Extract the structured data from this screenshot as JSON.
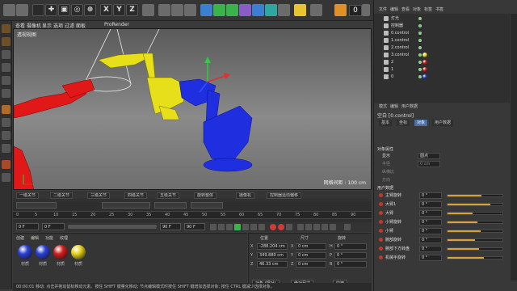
{
  "toolbar": {
    "axis_x": "X",
    "axis_y": "Y",
    "axis_z": "Z",
    "frame_value": "0"
  },
  "viewport": {
    "menu": [
      "查看",
      "摄像机",
      "显示",
      "选项",
      "过滤",
      "面板",
      "ProRender"
    ],
    "label": "透视视图",
    "grid_spacing": "网格间距 : 100 cm"
  },
  "object_tags": [
    "一级关节",
    "二级关节",
    "三级关节",
    "四级关节",
    "五级关节",
    "旋转整体",
    "摄像机",
    "控制器运动偏移"
  ],
  "timeline": {
    "marks": [
      "0",
      "5",
      "10",
      "15",
      "20",
      "25",
      "30",
      "35",
      "40",
      "45",
      "50",
      "55",
      "60",
      "65",
      "70",
      "75",
      "80",
      "85",
      "90"
    ],
    "current_frame": "0 F",
    "start_frame": "0 F",
    "end_frame": "90 F",
    "end_frame_2": "90 F"
  },
  "materials": {
    "menu": [
      "创建",
      "编辑",
      "功能",
      "纹理"
    ],
    "items": [
      {
        "name": "材质",
        "color": "#2a3fd6"
      },
      {
        "name": "材质",
        "color": "#2a3fd6"
      },
      {
        "name": "材质",
        "color": "#d41c1c"
      },
      {
        "name": "材质",
        "color": "#e6d21a"
      }
    ]
  },
  "coordinates": {
    "headers": [
      "位置",
      "尺寸",
      "旋转"
    ],
    "rows": [
      {
        "axis": "X",
        "pos": "-288.204 cm",
        "size": "0 cm",
        "rot": "H",
        "rot_val": "0 °"
      },
      {
        "axis": "Y",
        "pos": "349.880 cm",
        "size": "0 cm",
        "rot": "P",
        "rot_val": "0 °"
      },
      {
        "axis": "Z",
        "pos": "46.33 cm",
        "size": "0 cm",
        "rot": "B",
        "rot_val": "0 °"
      }
    ],
    "mode_button": "对象 (相对)",
    "size_button": "绝对尺寸",
    "apply_button": "应用"
  },
  "object_manager": {
    "menu": [
      "文件",
      "编辑",
      "查看",
      "对象",
      "标签",
      "书签"
    ],
    "rows": [
      {
        "name": "灯光",
        "mat": ""
      },
      {
        "name": "控制器",
        "mat": ""
      },
      {
        "name": "0.control",
        "mat": ""
      },
      {
        "name": "1.control",
        "mat": ""
      },
      {
        "name": "2.control",
        "mat": ""
      },
      {
        "name": "3.control",
        "mat": "#e6d21a"
      },
      {
        "name": "2",
        "mat": "#d41c1c"
      },
      {
        "name": "1",
        "mat": "#d41c1c"
      },
      {
        "name": "0",
        "mat": "#2a3fd6"
      }
    ]
  },
  "attributes": {
    "menu": [
      "模式",
      "编辑",
      "用户数据"
    ],
    "title": "空白 [0.control]",
    "tabs": [
      "基本",
      "坐标",
      "对象",
      "用户数据"
    ],
    "section1": "对象属性",
    "display_label": "显示",
    "display_value": "圆点",
    "radius_label": "半径",
    "radius_value": "0 cm",
    "aspect_label": "纵横比",
    "orientation_label": "方向",
    "section2": "用户数据",
    "params": [
      {
        "name": "主臂旋转",
        "value": "0 °",
        "fill": 0.62
      },
      {
        "name": "大臂1",
        "value": "0 °",
        "fill": 0.78
      },
      {
        "name": "大臂",
        "value": "0 °",
        "fill": 0.45
      },
      {
        "name": "小臂旋转",
        "value": "0 °",
        "fill": 0.55
      },
      {
        "name": "小臂",
        "value": "0 °",
        "fill": 0.6
      },
      {
        "name": "腕部旋转",
        "value": "0 °",
        "fill": 0.5
      },
      {
        "name": "腕部下方转盘",
        "value": "0 °",
        "fill": 0.58
      },
      {
        "name": "机械手旋转",
        "value": "0 °",
        "fill": 0.66
      }
    ]
  },
  "status": "00:00:01 移动: 点击并拖动鼠标移动元素。按住 SHIFT 键量化移动; 节点编辑模式时按住 SHIFT 键增加选择对象; 按住 CTRL 键减少选择对象。"
}
